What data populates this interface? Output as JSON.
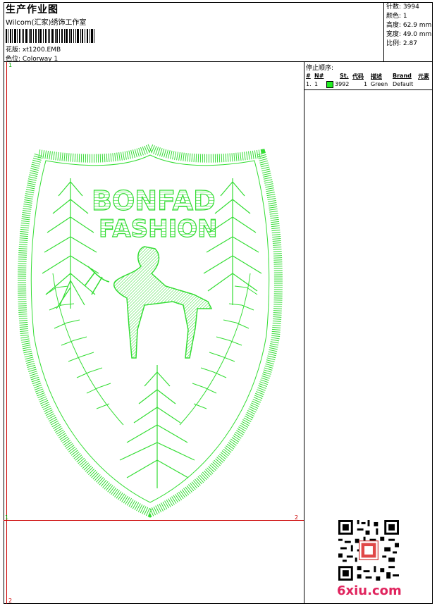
{
  "header": {
    "title": "生产作业图",
    "studio": "Wilcom(汇家)绣饰工作室",
    "design_label": "花版:",
    "design_file": "xt1200.EMB",
    "colorway_label": "色位:",
    "colorway": "Colorway 1"
  },
  "stats": {
    "stitches": "针数: 3994",
    "colors": "颜色: 1",
    "height": "高度: 62.9 mm",
    "width": "宽度: 49.0 mm",
    "scale": "比例: 2.87"
  },
  "stop_sequence": {
    "title": "停止顺序:",
    "columns": [
      "#",
      "N#",
      "St.",
      "代码",
      "描述",
      "Brand",
      "元素"
    ],
    "rows": [
      {
        "index": "1.",
        "needle": "1",
        "stitches": "3992",
        "code": "1",
        "desc": "Green",
        "brand": "Default",
        "color": "#22ee22"
      }
    ]
  },
  "design": {
    "text_line1": "BONFAD",
    "text_line2": "FASHION",
    "thread_color": "#33dd33"
  },
  "markers": {
    "top": "1",
    "left": "1",
    "right": "2",
    "bottom": "2"
  },
  "watermark": "6xiu.com"
}
